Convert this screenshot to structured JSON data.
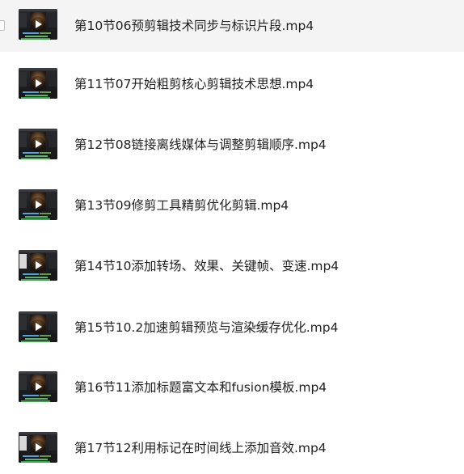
{
  "files": [
    {
      "name": "第10节06预剪辑技术同步与标识片段.mp4",
      "selected": true
    },
    {
      "name": "第11节07开始粗剪核心剪辑技术思想.mp4",
      "selected": false
    },
    {
      "name": "第12节08链接离线媒体与调整剪辑顺序.mp4",
      "selected": false
    },
    {
      "name": "第13节09修剪工具精剪优化剪辑.mp4",
      "selected": false
    },
    {
      "name": "第14节10添加转场、效果、关键帧、变速.mp4",
      "selected": false
    },
    {
      "name": "第15节10.2加速剪辑预览与渲染缓存优化.mp4",
      "selected": false
    },
    {
      "name": "第16节11添加标题富文本和fusion模板.mp4",
      "selected": false
    },
    {
      "name": "第17节12利用标记在时间线上添加音效.mp4",
      "selected": false
    }
  ],
  "thumbnail": {
    "icon": "play-icon",
    "colors": {
      "background": "#1c1d20",
      "viewer": "#6c4a2b",
      "track_blue": "#5aa0d8",
      "track_green": "#3ea34e"
    }
  },
  "colors": {
    "selected_row": "#f4f4f4",
    "text": "#222222"
  }
}
